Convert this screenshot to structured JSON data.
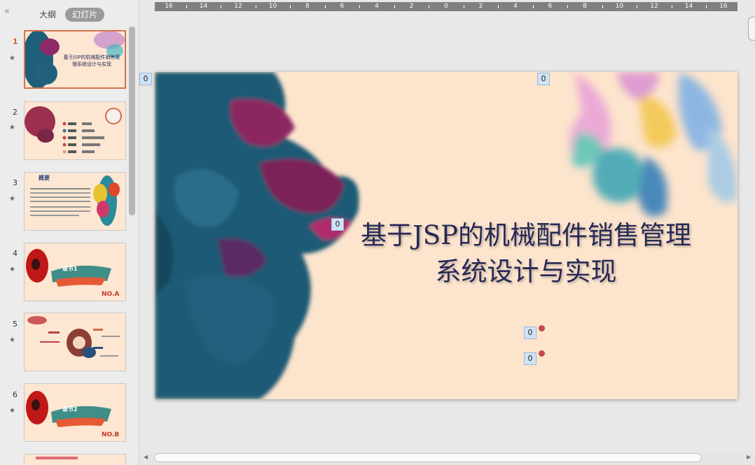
{
  "sidebar": {
    "collapse_glyph": "«",
    "tabs": [
      {
        "label": "大纲"
      },
      {
        "label": "幻灯片"
      }
    ],
    "star_glyph": "★",
    "slides": [
      {
        "number": "1",
        "thumb_title": "基于JSP的机械配件销售管理系统设计与实现"
      },
      {
        "number": "2"
      },
      {
        "number": "3",
        "thumb_title": "概要"
      },
      {
        "number": "4",
        "thumb_title": "章节1",
        "thumb_tag": "NO.A"
      },
      {
        "number": "5"
      },
      {
        "number": "6",
        "thumb_title": "章节2",
        "thumb_tag": "NO.B"
      }
    ]
  },
  "ruler": {
    "labels": [
      "16",
      "14",
      "12",
      "10",
      "8",
      "6",
      "4",
      "2",
      "0",
      "2",
      "4",
      "6",
      "8",
      "10",
      "12",
      "14",
      "16"
    ]
  },
  "slide": {
    "title_line1": "基于JSP的机械配件销售管理",
    "title_line2": "系统设计与实现"
  },
  "placeholder_tags": [
    "0",
    "0",
    "0",
    "0",
    "0"
  ],
  "colors": {
    "accent": "#d4724d",
    "title": "#262a55",
    "slide_bg": "#fde4cd",
    "dot": "#c24a4a"
  }
}
